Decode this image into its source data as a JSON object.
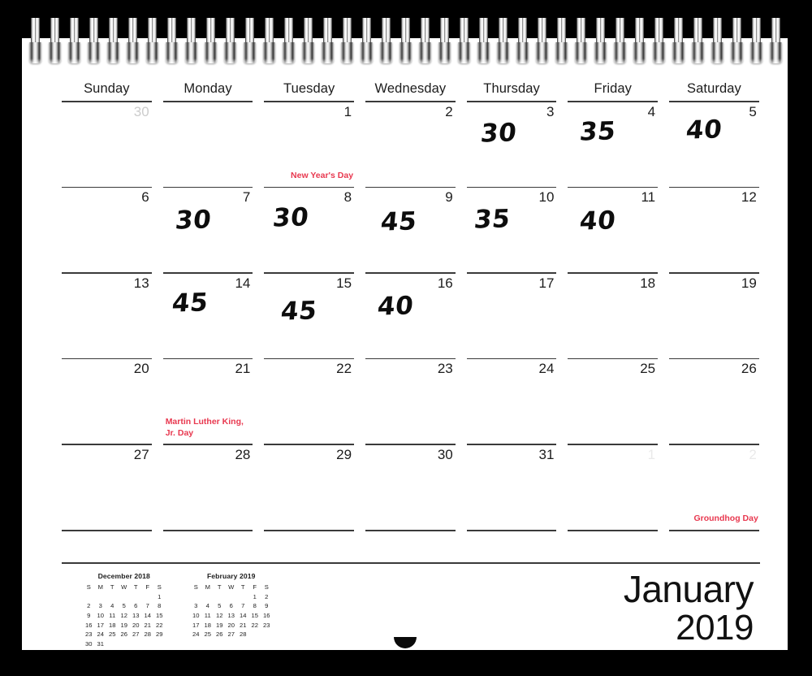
{
  "calendar": {
    "month_name": "January",
    "year": "2019",
    "accent_red": "#e8384f",
    "weekdays": [
      "Sunday",
      "Monday",
      "Tuesday",
      "Wednesday",
      "Thursday",
      "Friday",
      "Saturday"
    ],
    "weeks": [
      [
        {
          "num": "30",
          "style": "muted",
          "holiday": "",
          "note": ""
        },
        {
          "num": "",
          "style": "none",
          "holiday": "",
          "note": ""
        },
        {
          "num": "1",
          "style": "normal",
          "holiday": "New Year's Day",
          "holiday_align": "right",
          "note": ""
        },
        {
          "num": "2",
          "style": "normal",
          "holiday": "",
          "note": ""
        },
        {
          "num": "3",
          "style": "normal",
          "holiday": "",
          "note": "30"
        },
        {
          "num": "4",
          "style": "normal",
          "holiday": "",
          "note": "35"
        },
        {
          "num": "5",
          "style": "normal",
          "holiday": "",
          "note": "40"
        }
      ],
      [
        {
          "num": "6",
          "style": "normal",
          "holiday": "",
          "note": ""
        },
        {
          "num": "7",
          "style": "normal",
          "holiday": "",
          "note": "30"
        },
        {
          "num": "8",
          "style": "normal",
          "holiday": "",
          "note": "30"
        },
        {
          "num": "9",
          "style": "normal",
          "holiday": "",
          "note": "45"
        },
        {
          "num": "10",
          "style": "normal",
          "holiday": "",
          "note": "35"
        },
        {
          "num": "11",
          "style": "normal",
          "holiday": "",
          "note": "40"
        },
        {
          "num": "12",
          "style": "normal",
          "holiday": "",
          "note": ""
        }
      ],
      [
        {
          "num": "13",
          "style": "normal",
          "holiday": "",
          "note": ""
        },
        {
          "num": "14",
          "style": "normal",
          "holiday": "",
          "note": "45"
        },
        {
          "num": "15",
          "style": "normal",
          "holiday": "",
          "note": "45"
        },
        {
          "num": "16",
          "style": "normal",
          "holiday": "",
          "note": "40"
        },
        {
          "num": "17",
          "style": "normal",
          "holiday": "",
          "note": ""
        },
        {
          "num": "18",
          "style": "normal",
          "holiday": "",
          "note": ""
        },
        {
          "num": "19",
          "style": "normal",
          "holiday": "",
          "note": ""
        }
      ],
      [
        {
          "num": "20",
          "style": "normal",
          "holiday": "",
          "note": ""
        },
        {
          "num": "21",
          "style": "normal",
          "holiday": "Martin Luther King, Jr. Day",
          "holiday_align": "left",
          "note": ""
        },
        {
          "num": "22",
          "style": "normal",
          "holiday": "",
          "note": ""
        },
        {
          "num": "23",
          "style": "normal",
          "holiday": "",
          "note": ""
        },
        {
          "num": "24",
          "style": "normal",
          "holiday": "",
          "note": ""
        },
        {
          "num": "25",
          "style": "normal",
          "holiday": "",
          "note": ""
        },
        {
          "num": "26",
          "style": "normal",
          "holiday": "",
          "note": ""
        }
      ],
      [
        {
          "num": "27",
          "style": "normal",
          "holiday": "",
          "note": ""
        },
        {
          "num": "28",
          "style": "normal",
          "holiday": "",
          "note": ""
        },
        {
          "num": "29",
          "style": "normal",
          "holiday": "",
          "note": ""
        },
        {
          "num": "30",
          "style": "normal",
          "holiday": "",
          "note": ""
        },
        {
          "num": "31",
          "style": "normal",
          "holiday": "",
          "note": ""
        },
        {
          "num": "1",
          "style": "faint",
          "holiday": "",
          "note": ""
        },
        {
          "num": "2",
          "style": "faint",
          "holiday": "Groundhog Day",
          "holiday_align": "right",
          "note": ""
        }
      ]
    ],
    "mini_calendars": [
      {
        "title": "December 2018",
        "dow": [
          "S",
          "M",
          "T",
          "W",
          "T",
          "F",
          "S"
        ],
        "rows": [
          [
            "",
            "",
            "",
            "",
            "",
            "",
            "1"
          ],
          [
            "2",
            "3",
            "4",
            "5",
            "6",
            "7",
            "8"
          ],
          [
            "9",
            "10",
            "11",
            "12",
            "13",
            "14",
            "15"
          ],
          [
            "16",
            "17",
            "18",
            "19",
            "20",
            "21",
            "22"
          ],
          [
            "23",
            "24",
            "25",
            "26",
            "27",
            "28",
            "29"
          ],
          [
            "30",
            "31",
            "",
            "",
            "",
            "",
            ""
          ]
        ]
      },
      {
        "title": "February 2019",
        "dow": [
          "S",
          "M",
          "T",
          "W",
          "T",
          "F",
          "S"
        ],
        "rows": [
          [
            "",
            "",
            "",
            "",
            "",
            "1",
            "2"
          ],
          [
            "3",
            "4",
            "5",
            "6",
            "7",
            "8",
            "9"
          ],
          [
            "10",
            "11",
            "12",
            "13",
            "14",
            "15",
            "16"
          ],
          [
            "17",
            "18",
            "19",
            "20",
            "21",
            "22",
            "23"
          ],
          [
            "24",
            "25",
            "26",
            "27",
            "28",
            "",
            ""
          ]
        ]
      }
    ]
  }
}
